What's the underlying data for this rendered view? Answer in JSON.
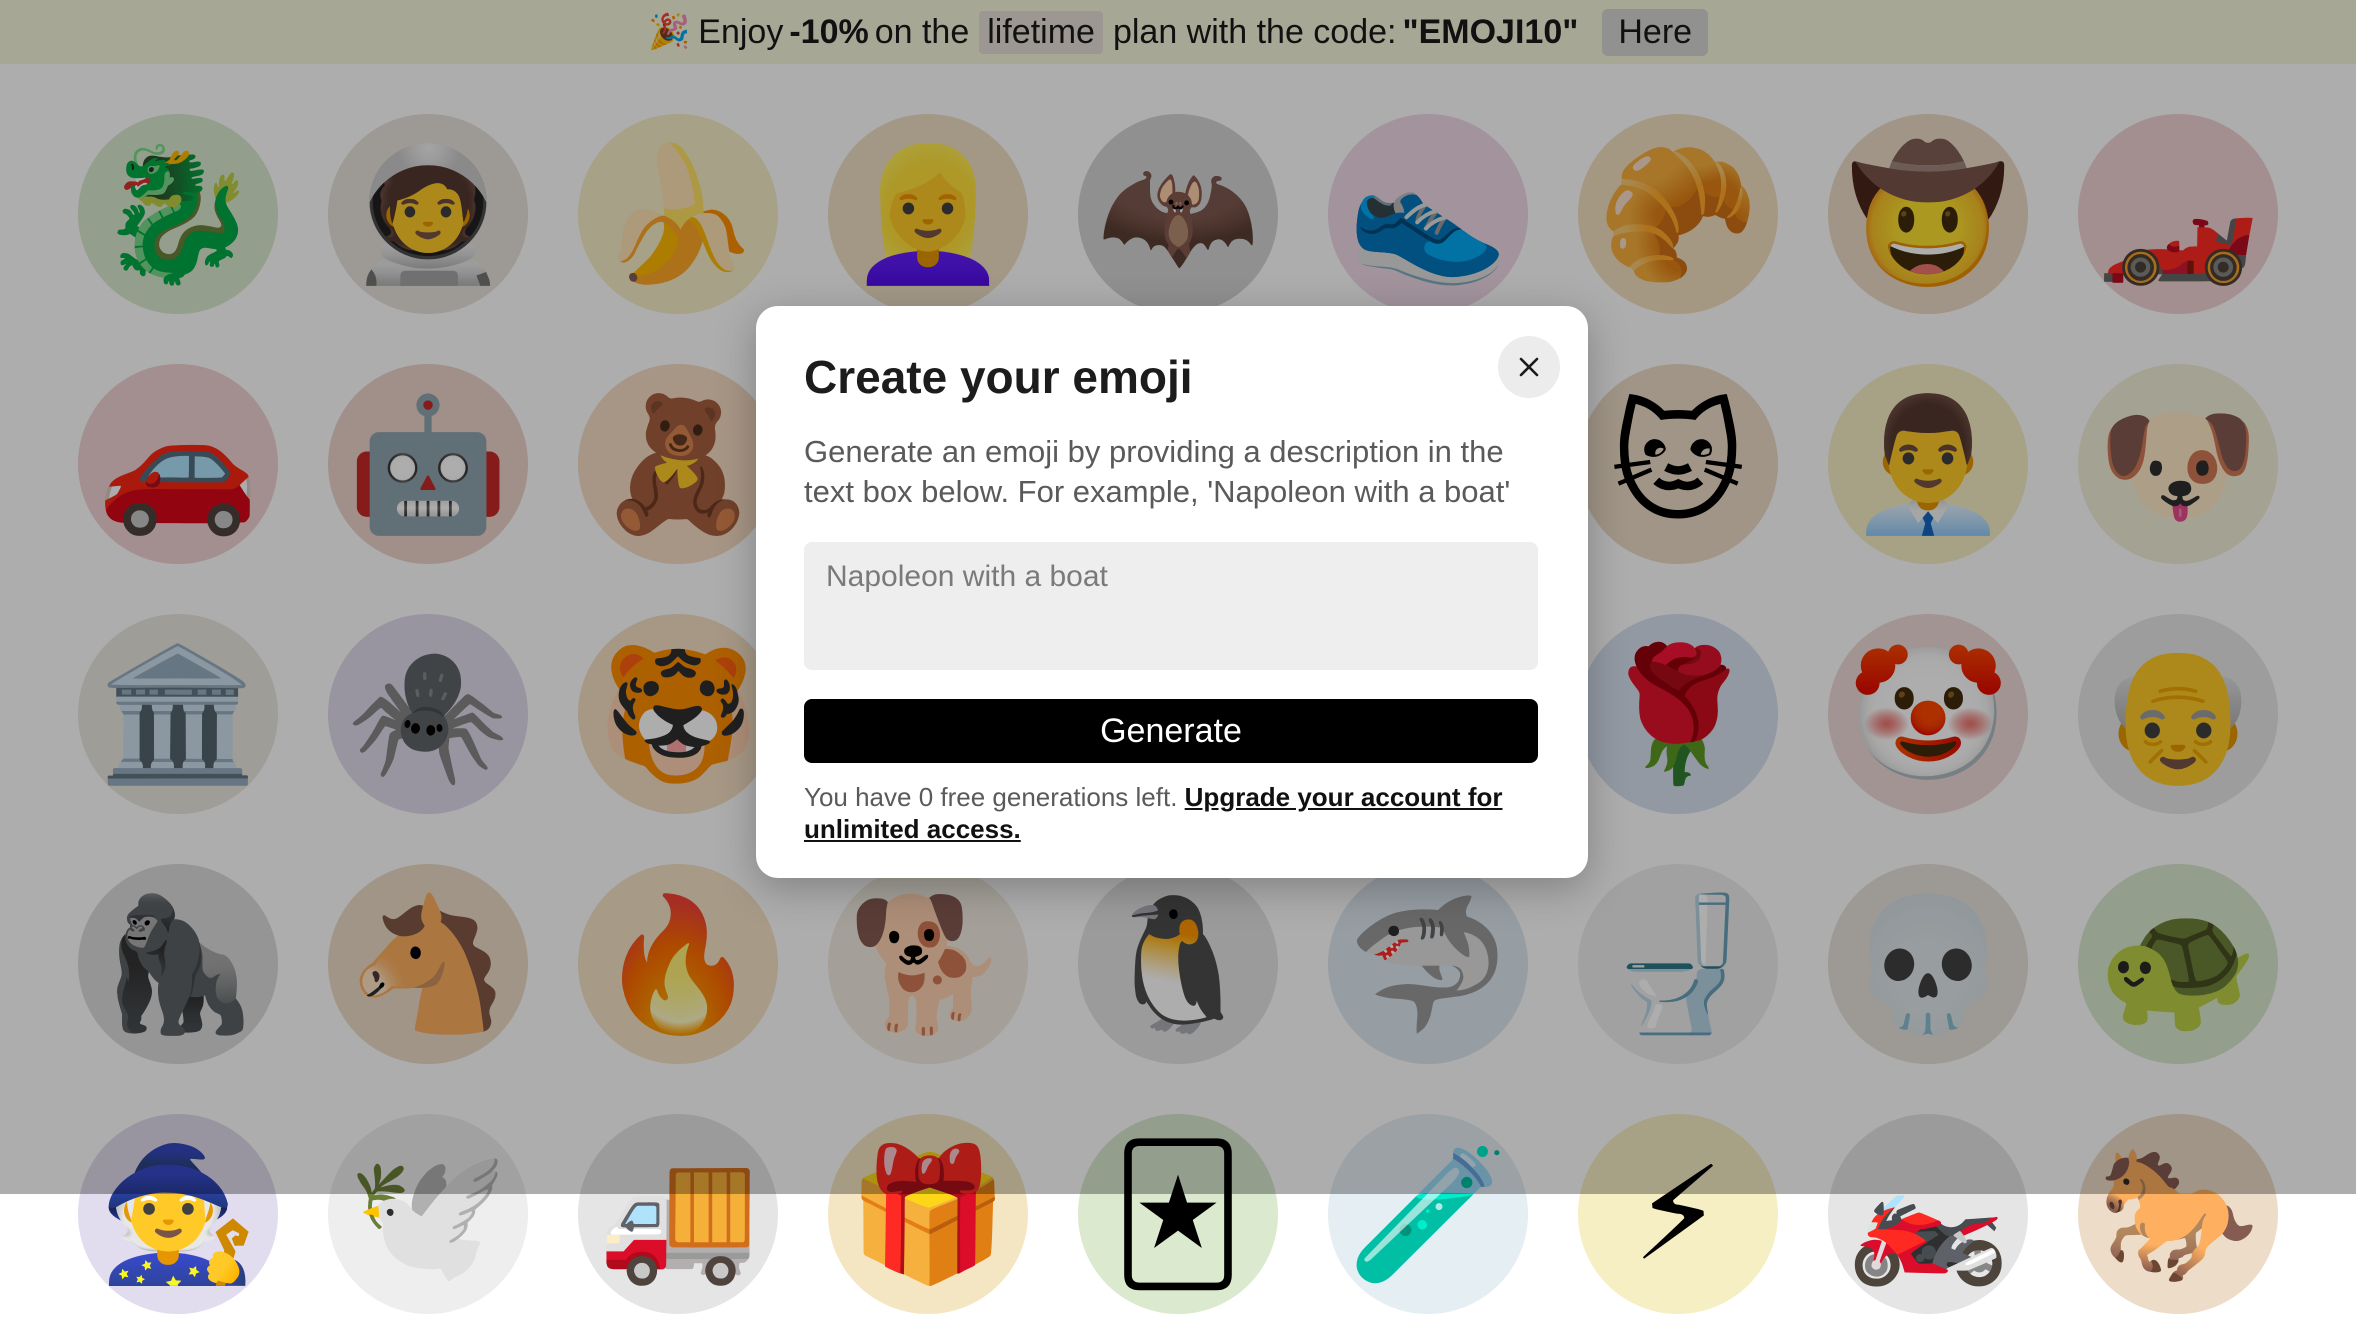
{
  "banner": {
    "party_emoji": "🎉",
    "text_enjoy": "Enjoy",
    "discount": "-10%",
    "text_on_the": "on the",
    "plan": "lifetime",
    "text_plan_code": "plan with the code:",
    "code": "\"EMOJI10\"",
    "here_label": "Here"
  },
  "grid": {
    "tiles": [
      {
        "emoji": "🐉",
        "bg": "#dbe9cf"
      },
      {
        "emoji": "🧑‍🚀",
        "bg": "#e7e2da"
      },
      {
        "emoji": "🍌",
        "bg": "#f5edc8"
      },
      {
        "emoji": "👱‍♀️",
        "bg": "#f0e0c6"
      },
      {
        "emoji": "🦇",
        "bg": "#d5d5d5"
      },
      {
        "emoji": "👟",
        "bg": "#efd9e8"
      },
      {
        "emoji": "🥐",
        "bg": "#f4e1c2"
      },
      {
        "emoji": "🤠",
        "bg": "#ecdcc8"
      },
      {
        "emoji": "🏎️",
        "bg": "#f1d3d3"
      },
      {
        "emoji": "🚗",
        "bg": "#f1d3d3"
      },
      {
        "emoji": "🤖",
        "bg": "#ecd5cb"
      },
      {
        "emoji": "🧸",
        "bg": "#f6dcc4"
      },
      {
        "emoji": "",
        "bg": "#ffffff"
      },
      {
        "emoji": "",
        "bg": "#ffffff"
      },
      {
        "emoji": "",
        "bg": "#ffffff"
      },
      {
        "emoji": "🐱",
        "bg": "#ecdcc8"
      },
      {
        "emoji": "👨‍💼",
        "bg": "#f6efc4"
      },
      {
        "emoji": "🐶",
        "bg": "#f2efd8"
      },
      {
        "emoji": "🏛️",
        "bg": "#ebe7e0"
      },
      {
        "emoji": "🕷️",
        "bg": "#e1dcee"
      },
      {
        "emoji": "🐯",
        "bg": "#f6e1c6"
      },
      {
        "emoji": "",
        "bg": "#ffffff"
      },
      {
        "emoji": "",
        "bg": "#ffffff"
      },
      {
        "emoji": "",
        "bg": "#ffffff"
      },
      {
        "emoji": "🌹",
        "bg": "#d8e2f1"
      },
      {
        "emoji": "🤡",
        "bg": "#f1dada"
      },
      {
        "emoji": "👴",
        "bg": "#e7e7e7"
      },
      {
        "emoji": "🦍",
        "bg": "#dcdcdc"
      },
      {
        "emoji": "🐴",
        "bg": "#ecdcc8"
      },
      {
        "emoji": "🔥",
        "bg": "#f6e3c6"
      },
      {
        "emoji": "🐕",
        "bg": "#f2ece2"
      },
      {
        "emoji": "🐧",
        "bg": "#e5e5e5"
      },
      {
        "emoji": "🦈",
        "bg": "#dde7f1"
      },
      {
        "emoji": "🚽",
        "bg": "#eeeeee"
      },
      {
        "emoji": "💀",
        "bg": "#e7e2da"
      },
      {
        "emoji": "🐢",
        "bg": "#dbe9cf"
      },
      {
        "emoji": "🧙",
        "bg": "#e1dcee"
      },
      {
        "emoji": "🕊️",
        "bg": "#eeeeee"
      },
      {
        "emoji": "🚚",
        "bg": "#e5e5e5"
      },
      {
        "emoji": "🎁",
        "bg": "#f4e6c2"
      },
      {
        "emoji": "🃏",
        "bg": "#dbe9cf"
      },
      {
        "emoji": "🧪",
        "bg": "#e5eef2"
      },
      {
        "emoji": "⚡",
        "bg": "#f6efc4"
      },
      {
        "emoji": "🏍️",
        "bg": "#e5e5e5"
      },
      {
        "emoji": "🐎",
        "bg": "#ecdcc8"
      }
    ]
  },
  "modal": {
    "title": "Create your emoji",
    "description": "Generate an emoji by providing a description in the text box below. For example, 'Napoleon with a boat'",
    "prompt_placeholder": "Napoleon with a boat",
    "prompt_value": "",
    "generate_label": "Generate",
    "free_generations_text": "You have 0 free generations left.",
    "upgrade_link": "Upgrade your account for unlimited access."
  }
}
